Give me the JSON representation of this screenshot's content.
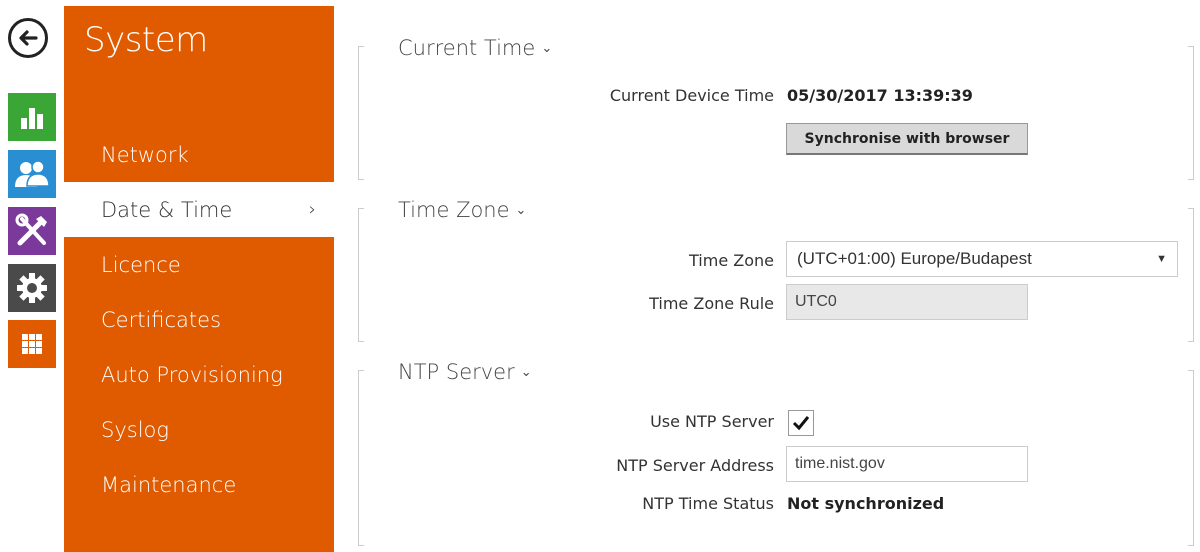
{
  "colors": {
    "accent": "#e05a00",
    "rail_green": "#3aa635",
    "rail_blue": "#2a8fd2",
    "rail_purple": "#7b3a9b",
    "rail_dark": "#4a4a4a"
  },
  "rail": {
    "items": [
      {
        "icon": "back-arrow-icon"
      },
      {
        "icon": "bar-chart-icon"
      },
      {
        "icon": "users-icon"
      },
      {
        "icon": "tools-icon"
      },
      {
        "icon": "gear-icon"
      },
      {
        "icon": "grid-icon"
      }
    ]
  },
  "sidebar": {
    "title": "System",
    "items": [
      {
        "label": "Network"
      },
      {
        "label": "Date & Time",
        "active": true
      },
      {
        "label": "Licence"
      },
      {
        "label": "Certificates"
      },
      {
        "label": "Auto Provisioning"
      },
      {
        "label": "Syslog"
      },
      {
        "label": "Maintenance"
      }
    ],
    "active_chevron": "›"
  },
  "current_time": {
    "title": "Current Time",
    "caret": "⌄",
    "device_time_label": "Current Device Time",
    "device_time_value": "05/30/2017 13:39:39",
    "sync_button": "Synchronise with browser"
  },
  "time_zone": {
    "title": "Time Zone",
    "caret": "⌄",
    "zone_label": "Time Zone",
    "zone_value": "(UTC+01:00) Europe/Budapest",
    "rule_label": "Time Zone Rule",
    "rule_value": "UTC0"
  },
  "ntp": {
    "title": "NTP Server",
    "caret": "⌄",
    "use_label": "Use NTP Server",
    "use_checked": true,
    "address_label": "NTP Server Address",
    "address_value": "time.nist.gov",
    "status_label": "NTP Time Status",
    "status_value": "Not synchronized"
  }
}
